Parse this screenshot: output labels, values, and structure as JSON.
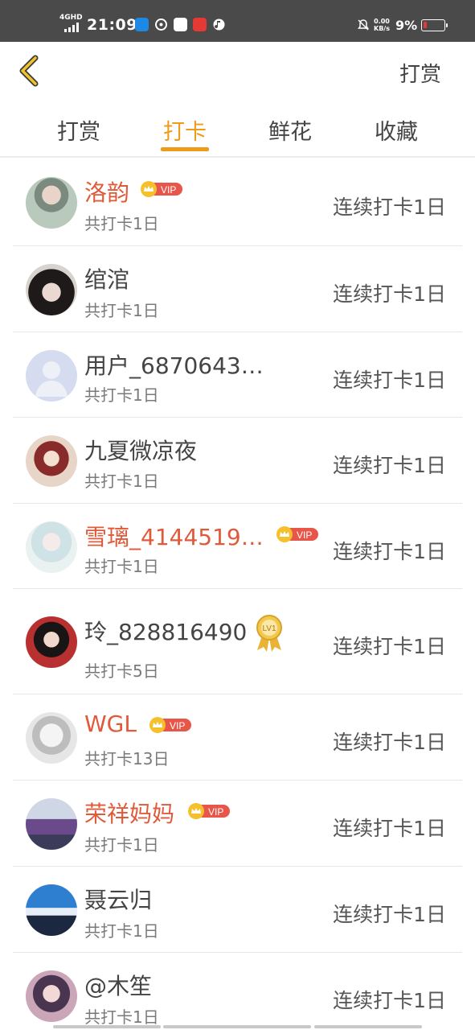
{
  "status_bar": {
    "network": "4GHD",
    "time": "21:09",
    "net_speed_value": "0.00",
    "net_speed_unit": "KB/s",
    "battery": "9%",
    "battery_level": 0.09,
    "colors": {
      "bg": "#4a4a4a",
      "battery_low": "#e53935"
    }
  },
  "header": {
    "back_icon": "chevron-left-icon",
    "title": "打赏"
  },
  "tabs": [
    {
      "label": "打赏",
      "active": false
    },
    {
      "label": "打卡",
      "active": true
    },
    {
      "label": "鲜花",
      "active": false
    },
    {
      "label": "收藏",
      "active": false
    }
  ],
  "accent_color": "#ee9b1c",
  "vip_name_color": "#e05a3a",
  "list": [
    {
      "name": "洛韵",
      "vip": true,
      "badge": "VIP",
      "sub": "共打卡1日",
      "right": "连续打卡1日"
    },
    {
      "name": "绾涫",
      "vip": false,
      "sub": "共打卡1日",
      "right": "连续打卡1日"
    },
    {
      "name": "用户_6870643…",
      "vip": false,
      "sub": "共打卡1日",
      "right": "连续打卡1日"
    },
    {
      "name": "九夏微凉夜",
      "vip": false,
      "sub": "共打卡1日",
      "right": "连续打卡1日"
    },
    {
      "name": "雪璃_4144519…",
      "vip": true,
      "badge": "VIP",
      "sub": "共打卡1日",
      "right": "连续打卡1日"
    },
    {
      "name": "玲_828816490",
      "vip": false,
      "medal": "LV1",
      "sub": "共打卡5日",
      "right": "连续打卡1日"
    },
    {
      "name": "WGL",
      "vip": true,
      "badge": "VIP",
      "sub": "共打卡13日",
      "right": "连续打卡1日"
    },
    {
      "name": "荣祥妈妈",
      "vip": true,
      "badge": "VIP",
      "sub": "共打卡1日",
      "right": "连续打卡1日"
    },
    {
      "name": "聂云归",
      "vip": false,
      "sub": "共打卡1日",
      "right": "连续打卡1日"
    },
    {
      "name": "@木笙",
      "vip": false,
      "sub": "共打卡1日",
      "right": "连续打卡1日"
    }
  ]
}
